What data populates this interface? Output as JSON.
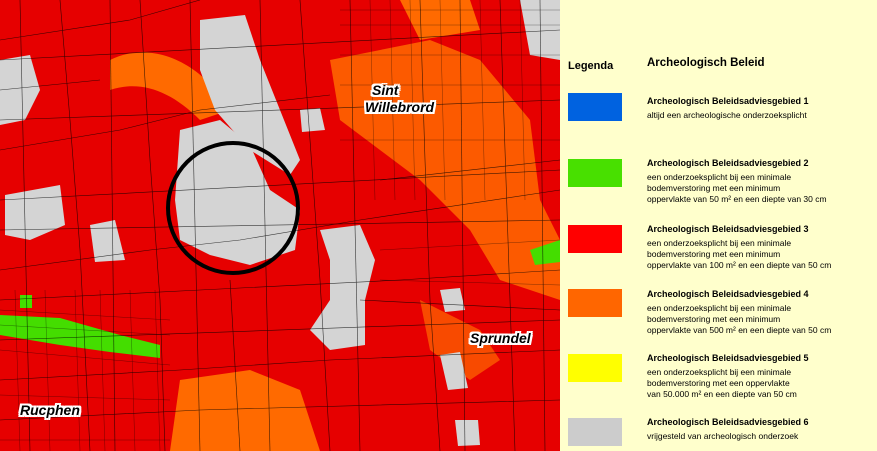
{
  "map": {
    "places": {
      "sint_willebrord_line1": "Sint",
      "sint_willebrord_line2": "Willebrord",
      "sprundel": "Sprundel",
      "rucphen": "Rucphen"
    },
    "colors": {
      "zone2": "#44dd00",
      "zone3": "#e60000",
      "zone4": "#ff6a00",
      "zone6": "#d4d4d4",
      "circle": "#000000"
    }
  },
  "legend": {
    "heading": "Legenda",
    "title": "Archeologisch Beleid",
    "entries": [
      {
        "color": "#0062e0",
        "title": "Archeologisch Beleidsadviesgebied 1",
        "lines": [
          "altijd een archeologische onderzoeksplicht"
        ]
      },
      {
        "color": "#48e000",
        "title": "Archeologisch Beleidsadviesgebied 2",
        "lines": [
          "een onderzoeksplicht bij een minimale",
          "bodemverstoring met een minimum",
          "oppervlakte van 50 m² en een diepte van 30 cm"
        ]
      },
      {
        "color": "#ff0000",
        "title": "Archeologisch Beleidsadviesgebied 3",
        "lines": [
          "een onderzoeksplicht bij een minimale",
          "bodemverstoring met een minimum",
          "oppervlakte van 100 m² en een diepte van 50 cm"
        ]
      },
      {
        "color": "#ff6600",
        "title": "Archeologisch Beleidsadviesgebied 4",
        "lines": [
          "een onderzoeksplicht bij een minimale",
          "bodemverstoring met een minimum",
          "oppervlakte van 500 m² en een diepte van 50 cm"
        ]
      },
      {
        "color": "#ffff00",
        "title": "Archeologisch Beleidsadviesgebied 5",
        "lines": [
          "een onderzoeksplicht bij een minimale",
          "bodemverstoring met een oppervlakte",
          "van 50.000 m² en een diepte van 50 cm"
        ]
      },
      {
        "color": "#cccccc",
        "title": "Archeologisch Beleidsadviesgebied 6",
        "lines": [
          "vrijgesteld van archeologisch onderzoek"
        ]
      }
    ]
  }
}
